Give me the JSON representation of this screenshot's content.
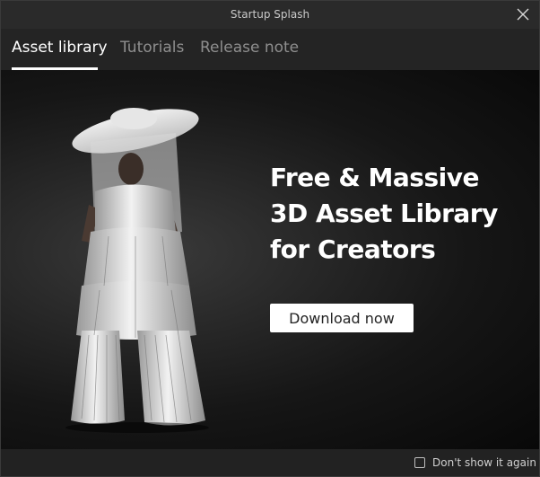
{
  "window": {
    "title": "Startup Splash"
  },
  "tabs": [
    {
      "label": "Asset library",
      "active": true
    },
    {
      "label": "Tutorials",
      "active": false
    },
    {
      "label": "Release note",
      "active": false
    }
  ],
  "hero": {
    "headline_lines": [
      "Free & Massive",
      "3D Asset Library",
      "for Creators"
    ],
    "cta_label": "Download now",
    "image_subject": "figure in white wide-brim hat and pleated white gown"
  },
  "footer": {
    "dont_show_label": "Don't show it again",
    "dont_show_checked": false
  },
  "colors": {
    "titlebar_bg": "#2a2a2a",
    "tabbar_bg": "#242424",
    "hero_bg": "#161616",
    "active_tab": "#ffffff",
    "inactive_tab": "#8e8e8e",
    "button_bg": "#ffffff"
  },
  "icons": {
    "close": "close-icon",
    "checkbox": "checkbox-icon"
  }
}
